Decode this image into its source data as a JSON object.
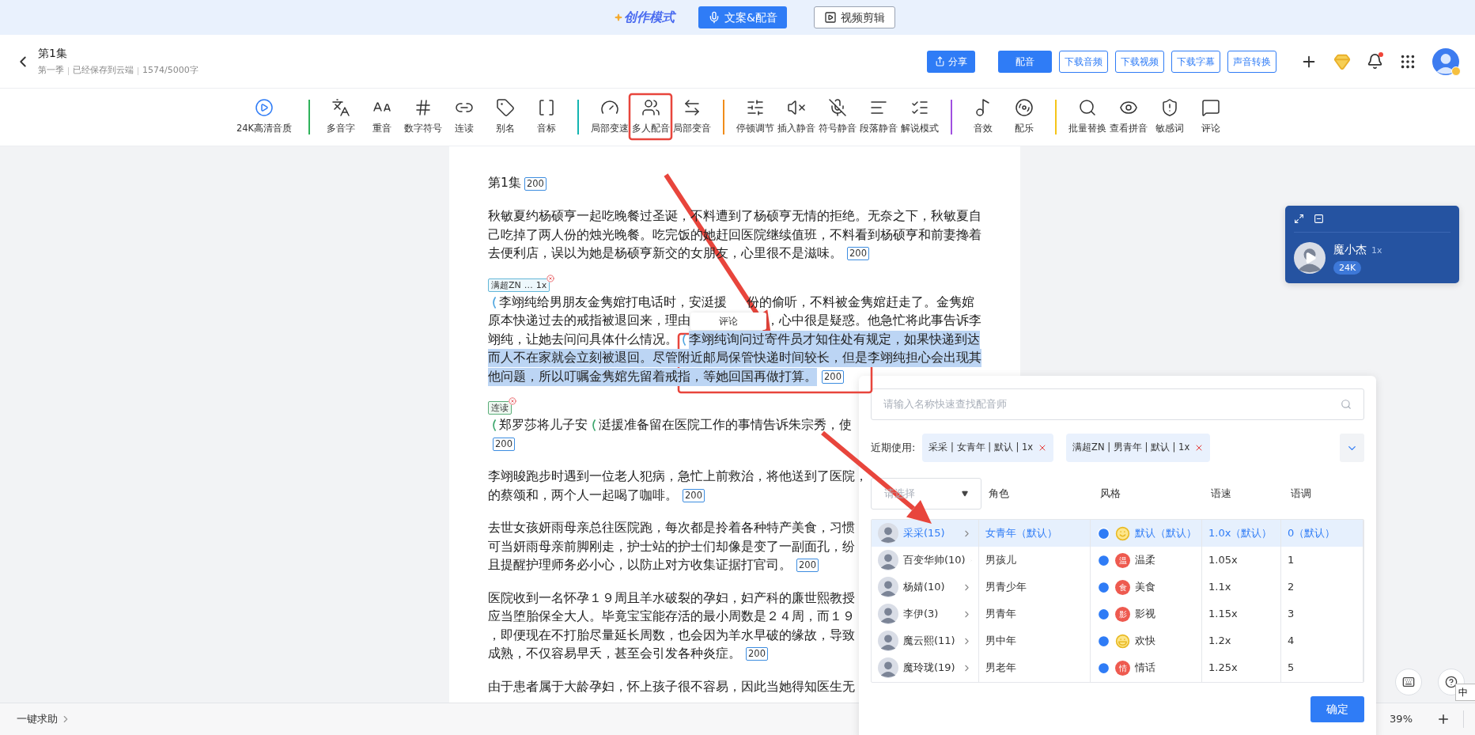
{
  "topbar": {
    "logo": "创作模式",
    "modes": [
      {
        "label": "文案&配音",
        "selected": true
      },
      {
        "label": "视频剪辑",
        "selected": false
      }
    ]
  },
  "header": {
    "title": "第1集",
    "meta": [
      "第一季",
      "已经保存到云端",
      "1574/5000字"
    ],
    "buttons": [
      {
        "label": "分享",
        "kind": "share"
      },
      {
        "label": "配音",
        "kind": "primary"
      },
      {
        "label": "下载音频",
        "kind": "outline"
      },
      {
        "label": "下载视频",
        "kind": "outline"
      },
      {
        "label": "下载字幕",
        "kind": "outline"
      },
      {
        "label": "声音转换",
        "kind": "outline"
      }
    ],
    "bell_unread": true
  },
  "toolbar": [
    {
      "items": [
        {
          "label": "24K高清音质"
        }
      ]
    },
    {
      "color": "#2fb25a",
      "items": [
        {
          "label": "多音字"
        },
        {
          "label": "重音"
        },
        {
          "label": "数字符号"
        },
        {
          "label": "连读"
        },
        {
          "label": "别名"
        },
        {
          "label": "音标"
        }
      ]
    },
    {
      "color": "#13b5b1",
      "items": [
        {
          "label": "局部变速"
        },
        {
          "label": "多人配音"
        },
        {
          "label": "局部变音"
        }
      ]
    },
    {
      "color": "#f08c1a",
      "items": [
        {
          "label": "停顿调节"
        },
        {
          "label": "插入静音"
        },
        {
          "label": "符号静音"
        },
        {
          "label": "段落静音"
        },
        {
          "label": "解说模式"
        }
      ]
    },
    {
      "color": "#a050e0",
      "items": [
        {
          "label": "音效"
        },
        {
          "label": "配乐"
        }
      ]
    },
    {
      "color": "#f5c518",
      "items": [
        {
          "label": "批量替换"
        },
        {
          "label": "查看拼音"
        },
        {
          "label": "敏感词"
        },
        {
          "label": "评论"
        }
      ]
    }
  ],
  "document": {
    "title": "第1集",
    "count": "200",
    "paragraphs": [
      {
        "lines": [
          {
            "segments": [
              {
                "text": "秋敏夏约杨硕亨一起吃晚餐过圣诞，不料遭到了杨硕亨无情的拒绝。无奈之下，秋敏夏自",
                "highlighted": false,
                "marker": false
              }
            ]
          },
          {
            "segments": [
              {
                "text": "己吃掉了两人份的烛光晚餐。吃完饭的她赶回医院继续值班，不料看到杨硕亨和前妻搀着",
                "highlighted": false,
                "marker": false
              }
            ]
          },
          {
            "segments": [
              {
                "text": "去便利店，误以为她是杨硕亨新交的女朋友，心里很不是滋味。",
                "highlighted": false,
                "marker": false
              }
            ],
            "count": "200"
          }
        ]
      },
      {
        "tag": {
          "kind": "voice",
          "parts": [
            "满超ZN",
            "…",
            "1x"
          ]
        },
        "lines": [
          {
            "segments": [
              {
                "text": "李翊纯给男朋友金隽婠打电话时，安涏援",
                "highlighted": false,
                "marker": true
              },
              {
                "text": "份的偷听，不料被金隽婠赶走了。金隽婠",
                "highlighted": false,
                "marker": false
              }
            ]
          },
          {
            "comment": "评论",
            "segments": [
              {
                "text": "原本快递过去的戒指被退回来，理由",
                "highlighted": false,
                "marker": false
              },
              {
                "text": "，心中很是疑惑。他急忙将此事告诉李",
                "highlighted": false,
                "marker": false
              }
            ]
          },
          {
            "segments": [
              {
                "text": "翊纯，让她去问问具体什么情况。",
                "highlighted": false,
                "marker": false
              },
              {
                "text": "李翊纯询问过寄件员才知住处有规定，如果快递到达",
                "highlighted": true,
                "marker": true
              }
            ]
          },
          {
            "segments": [
              {
                "text": "而人不在家就会立刻被退回。尽管附近邮局保管快递时间较长，但是李翊纯担心会出现其",
                "highlighted": true,
                "marker": false
              }
            ]
          },
          {
            "segments": [
              {
                "text": "他问题，所以叮嘱金隽婠先留着戒指，等她回国再做打算。",
                "highlighted": true,
                "marker": false
              }
            ],
            "count": "200"
          }
        ]
      },
      {
        "tag": {
          "kind": "link",
          "parts": [
            "连读"
          ]
        },
        "lines": [
          {
            "segments": [
              {
                "text": "郑罗莎将儿子安",
                "highlighted": false,
                "marker": true
              },
              {
                "text": "涏援准备留在医院工作的事情告诉朱宗秀，使",
                "highlighted": false,
                "marker": true
              }
            ]
          },
          {
            "count": "200"
          }
        ]
      },
      {
        "lines": [
          {
            "segments": [
              {
                "text": "李翊晙跑步时遇到一位老人犯病，急忙上前救治，将他送到了医院，",
                "highlighted": false,
                "marker": false
              }
            ]
          },
          {
            "segments": [
              {
                "text": "的蔡颂和，两个人一起喝了咖啡。",
                "highlighted": false,
                "marker": false
              }
            ],
            "count": "200"
          }
        ]
      },
      {
        "lines": [
          {
            "segments": [
              {
                "text": "去世女孩妍雨母亲总往医院跑，每次都是拎着各种特产美食，习惯",
                "highlighted": false,
                "marker": false
              }
            ]
          },
          {
            "segments": [
              {
                "text": "可当妍雨母亲前脚刚走，护士站的护士们却像是变了一副面孔，纷",
                "highlighted": false,
                "marker": false
              }
            ]
          },
          {
            "segments": [
              {
                "text": "且提醒护理师务必小心，以防止对方收集证据打官司。",
                "highlighted": false,
                "marker": false
              }
            ],
            "count": "200"
          }
        ]
      },
      {
        "lines": [
          {
            "segments": [
              {
                "text": "医院收到一名怀孕１９周且羊水破裂的孕妇，妇产科的廉世熙教授",
                "highlighted": false,
                "marker": false
              }
            ]
          },
          {
            "segments": [
              {
                "text": "应当堕胎保全大人。毕竟宝宝能存活的最小周数是２４周，而１９",
                "highlighted": false,
                "marker": false
              }
            ]
          },
          {
            "segments": [
              {
                "text": "，即便现在不打胎尽量延长周数，也会因为羊水早破的缘故，导致",
                "highlighted": false,
                "marker": false
              }
            ]
          },
          {
            "segments": [
              {
                "text": "成熟，不仅容易早夭，甚至会引发各种炎症。",
                "highlighted": false,
                "marker": false
              }
            ],
            "count": "200"
          }
        ]
      },
      {
        "lines": [
          {
            "segments": [
              {
                "text": "由于患者属于大龄孕妇，怀上孩子很不容易，因此当她得知医生无",
                "highlighted": false,
                "marker": false
              }
            ]
          }
        ]
      }
    ]
  },
  "player_card": {
    "name": "魔小杰",
    "speed": "1x",
    "quality": "24K"
  },
  "voice_panel": {
    "search_placeholder": "请输入名称快速查找配音师",
    "recent_label": "近期使用:",
    "recent": [
      "采采 | 女青年 | 默认 | 1x",
      "满超ZN | 男青年 | 默认 | 1x"
    ],
    "filter_placeholder": "请选择",
    "columns": [
      "角色",
      "风格",
      "语速",
      "语调"
    ],
    "voices": [
      {
        "name": "采采(15)",
        "selected": true
      },
      {
        "name": "百变华帅(10)",
        "selected": false
      },
      {
        "name": "杨婧(10)",
        "selected": false
      },
      {
        "name": "李伊(3)",
        "selected": false
      },
      {
        "name": "魔云熙(11)",
        "selected": false
      },
      {
        "name": "魔玲珑(19)",
        "selected": false
      }
    ],
    "roles": [
      {
        "label": "女青年（默认）",
        "selected": true
      },
      {
        "label": "男孩儿",
        "selected": false
      },
      {
        "label": "男青少年",
        "selected": false
      },
      {
        "label": "男青年",
        "selected": false
      },
      {
        "label": "男中年",
        "selected": false
      },
      {
        "label": "男老年",
        "selected": false
      }
    ],
    "styles": [
      {
        "label": "默认（默认）",
        "kind": "smile",
        "selected": true
      },
      {
        "label": "温柔",
        "kind": "badge",
        "badge": "温",
        "selected": false
      },
      {
        "label": "美食",
        "kind": "badge",
        "badge": "食",
        "selected": false
      },
      {
        "label": "影视",
        "kind": "badge",
        "badge": "影",
        "selected": false
      },
      {
        "label": "欢快",
        "kind": "laugh",
        "selected": false
      },
      {
        "label": "情话",
        "kind": "badge",
        "badge": "情",
        "selected": false
      }
    ],
    "speeds": [
      {
        "label": "1.0x（默认）",
        "selected": true
      },
      {
        "label": "1.05x",
        "selected": false
      },
      {
        "label": "1.1x",
        "selected": false
      },
      {
        "label": "1.15x",
        "selected": false
      },
      {
        "label": "1.2x",
        "selected": false
      },
      {
        "label": "1.25x",
        "selected": false
      }
    ],
    "tones": [
      {
        "label": "0（默认）",
        "selected": true
      },
      {
        "label": "1",
        "selected": false
      },
      {
        "label": "2",
        "selected": false
      },
      {
        "label": "3",
        "selected": false
      },
      {
        "label": "4",
        "selected": false
      },
      {
        "label": "5",
        "selected": false
      }
    ],
    "confirm": "确定"
  },
  "bottom_bar": {
    "help": "一键求助",
    "zoom": "39%"
  },
  "ime": "中"
}
